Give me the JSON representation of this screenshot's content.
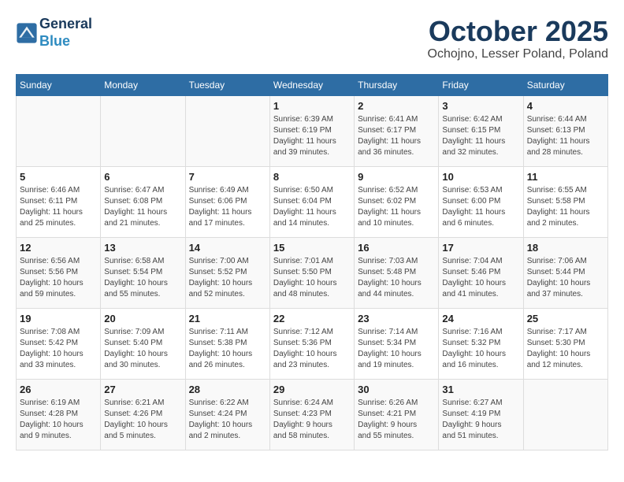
{
  "header": {
    "logo_line1": "General",
    "logo_line2": "Blue",
    "month": "October 2025",
    "location": "Ochojno, Lesser Poland, Poland"
  },
  "weekdays": [
    "Sunday",
    "Monday",
    "Tuesday",
    "Wednesday",
    "Thursday",
    "Friday",
    "Saturday"
  ],
  "weeks": [
    [
      {
        "day": "",
        "info": ""
      },
      {
        "day": "",
        "info": ""
      },
      {
        "day": "",
        "info": ""
      },
      {
        "day": "1",
        "info": "Sunrise: 6:39 AM\nSunset: 6:19 PM\nDaylight: 11 hours\nand 39 minutes."
      },
      {
        "day": "2",
        "info": "Sunrise: 6:41 AM\nSunset: 6:17 PM\nDaylight: 11 hours\nand 36 minutes."
      },
      {
        "day": "3",
        "info": "Sunrise: 6:42 AM\nSunset: 6:15 PM\nDaylight: 11 hours\nand 32 minutes."
      },
      {
        "day": "4",
        "info": "Sunrise: 6:44 AM\nSunset: 6:13 PM\nDaylight: 11 hours\nand 28 minutes."
      }
    ],
    [
      {
        "day": "5",
        "info": "Sunrise: 6:46 AM\nSunset: 6:11 PM\nDaylight: 11 hours\nand 25 minutes."
      },
      {
        "day": "6",
        "info": "Sunrise: 6:47 AM\nSunset: 6:08 PM\nDaylight: 11 hours\nand 21 minutes."
      },
      {
        "day": "7",
        "info": "Sunrise: 6:49 AM\nSunset: 6:06 PM\nDaylight: 11 hours\nand 17 minutes."
      },
      {
        "day": "8",
        "info": "Sunrise: 6:50 AM\nSunset: 6:04 PM\nDaylight: 11 hours\nand 14 minutes."
      },
      {
        "day": "9",
        "info": "Sunrise: 6:52 AM\nSunset: 6:02 PM\nDaylight: 11 hours\nand 10 minutes."
      },
      {
        "day": "10",
        "info": "Sunrise: 6:53 AM\nSunset: 6:00 PM\nDaylight: 11 hours\nand 6 minutes."
      },
      {
        "day": "11",
        "info": "Sunrise: 6:55 AM\nSunset: 5:58 PM\nDaylight: 11 hours\nand 2 minutes."
      }
    ],
    [
      {
        "day": "12",
        "info": "Sunrise: 6:56 AM\nSunset: 5:56 PM\nDaylight: 10 hours\nand 59 minutes."
      },
      {
        "day": "13",
        "info": "Sunrise: 6:58 AM\nSunset: 5:54 PM\nDaylight: 10 hours\nand 55 minutes."
      },
      {
        "day": "14",
        "info": "Sunrise: 7:00 AM\nSunset: 5:52 PM\nDaylight: 10 hours\nand 52 minutes."
      },
      {
        "day": "15",
        "info": "Sunrise: 7:01 AM\nSunset: 5:50 PM\nDaylight: 10 hours\nand 48 minutes."
      },
      {
        "day": "16",
        "info": "Sunrise: 7:03 AM\nSunset: 5:48 PM\nDaylight: 10 hours\nand 44 minutes."
      },
      {
        "day": "17",
        "info": "Sunrise: 7:04 AM\nSunset: 5:46 PM\nDaylight: 10 hours\nand 41 minutes."
      },
      {
        "day": "18",
        "info": "Sunrise: 7:06 AM\nSunset: 5:44 PM\nDaylight: 10 hours\nand 37 minutes."
      }
    ],
    [
      {
        "day": "19",
        "info": "Sunrise: 7:08 AM\nSunset: 5:42 PM\nDaylight: 10 hours\nand 33 minutes."
      },
      {
        "day": "20",
        "info": "Sunrise: 7:09 AM\nSunset: 5:40 PM\nDaylight: 10 hours\nand 30 minutes."
      },
      {
        "day": "21",
        "info": "Sunrise: 7:11 AM\nSunset: 5:38 PM\nDaylight: 10 hours\nand 26 minutes."
      },
      {
        "day": "22",
        "info": "Sunrise: 7:12 AM\nSunset: 5:36 PM\nDaylight: 10 hours\nand 23 minutes."
      },
      {
        "day": "23",
        "info": "Sunrise: 7:14 AM\nSunset: 5:34 PM\nDaylight: 10 hours\nand 19 minutes."
      },
      {
        "day": "24",
        "info": "Sunrise: 7:16 AM\nSunset: 5:32 PM\nDaylight: 10 hours\nand 16 minutes."
      },
      {
        "day": "25",
        "info": "Sunrise: 7:17 AM\nSunset: 5:30 PM\nDaylight: 10 hours\nand 12 minutes."
      }
    ],
    [
      {
        "day": "26",
        "info": "Sunrise: 6:19 AM\nSunset: 4:28 PM\nDaylight: 10 hours\nand 9 minutes."
      },
      {
        "day": "27",
        "info": "Sunrise: 6:21 AM\nSunset: 4:26 PM\nDaylight: 10 hours\nand 5 minutes."
      },
      {
        "day": "28",
        "info": "Sunrise: 6:22 AM\nSunset: 4:24 PM\nDaylight: 10 hours\nand 2 minutes."
      },
      {
        "day": "29",
        "info": "Sunrise: 6:24 AM\nSunset: 4:23 PM\nDaylight: 9 hours\nand 58 minutes."
      },
      {
        "day": "30",
        "info": "Sunrise: 6:26 AM\nSunset: 4:21 PM\nDaylight: 9 hours\nand 55 minutes."
      },
      {
        "day": "31",
        "info": "Sunrise: 6:27 AM\nSunset: 4:19 PM\nDaylight: 9 hours\nand 51 minutes."
      },
      {
        "day": "",
        "info": ""
      }
    ]
  ]
}
